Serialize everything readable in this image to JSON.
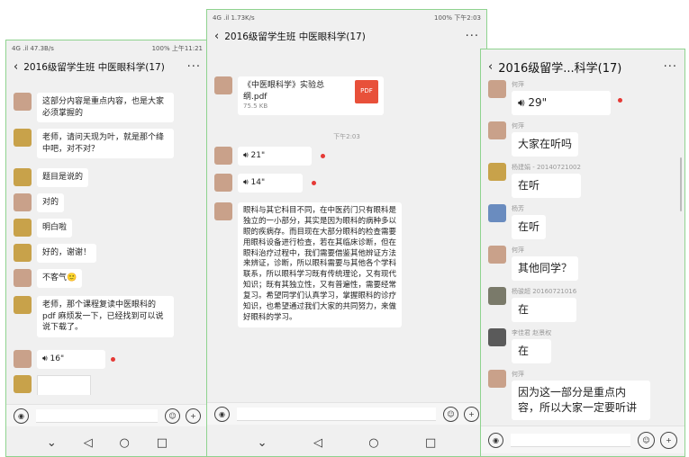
{
  "phones": {
    "p1": {
      "status": {
        "left": "4G .il 47.3B/s",
        "right": "100% 上午11:21"
      },
      "title": "2016级留学生班 中医眼科学(17)",
      "messages": [
        {
          "text": "这部分内容是重点内容，也是大家必须掌握的"
        },
        {
          "text": "老师，请问天现为叶，就是那个绛中吧，对不对？"
        },
        {
          "text": "题目是说的"
        },
        {
          "text": "对的"
        },
        {
          "text": "明白啦"
        },
        {
          "text": "好的，谢谢！"
        },
        {
          "text": "不客气🙂"
        },
        {
          "text": "老师，那个课程复读中医眼科的pdf 麻烦发一下，已经找到可以说说下载了。"
        },
        {
          "voice": "16\""
        }
      ]
    },
    "p2": {
      "status": {
        "left": "4G .il 1.73K/s",
        "right": "100% 下午2:03"
      },
      "title": "2016级留学生班 中医眼科学(17)",
      "file": {
        "name": "《中医眼科学》实验总纲.pdf",
        "size": "75.5 KB",
        "badge": "PDF"
      },
      "time": "下午2:03",
      "voices": [
        "21\"",
        "14\""
      ],
      "long_text": "眼科与其它科目不同，在中医药门只有眼科是独立的一小部分，其实是因为眼科的病种多以眼的疾病存。而目现在大部分眼科的检查需要用眼科设备进行检查，若在其临床诊断，但在眼科治疗过程中，我们需要借鉴其他辨证方法来辨证，诊断，所以眼科需要与其他各个学科联系，所以眼科学习既有传统理论，又有现代知识；既有其独立性，又有普遍性，需要经常复习。希望同学们认真学习，掌握眼科的诊疗知识，也希望通过我们大家的共同努力，来做好眼科的学习。"
    },
    "p3": {
      "title": "2016级留学...科学(17)",
      "messages": [
        {
          "sender": "何萍",
          "voice": "29\""
        },
        {
          "sender": "何萍",
          "text": "大家在听吗"
        },
        {
          "sender": "杨建娟 - 20140721002",
          "text": "在听"
        },
        {
          "sender": "杨芳",
          "text": "在听"
        },
        {
          "sender": "何萍",
          "text": "其他同学？"
        },
        {
          "sender": "杨骏超 20160721016",
          "text": "在"
        },
        {
          "sender": "李佳君 赵景权",
          "text": "在"
        },
        {
          "sender": "何萍",
          "text": "因为这一部分是重点内容，所以大家一定要听讲"
        }
      ]
    }
  },
  "icons": {
    "voice_btn": "voice-icon",
    "emoji": "emoji-icon",
    "add": "plus-icon"
  },
  "colors": {
    "bubble": "#ffffff",
    "background": "#f0f0f0",
    "unread_dot": "#e53935",
    "pdf": "#e8503a"
  }
}
